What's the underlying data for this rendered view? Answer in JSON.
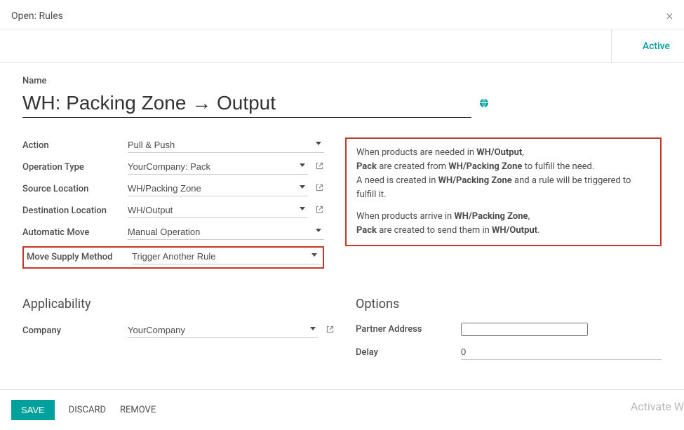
{
  "header": {
    "title": "Open: Rules"
  },
  "status": {
    "active_label": "Active"
  },
  "name": {
    "label": "Name",
    "value": "WH: Packing Zone → Output"
  },
  "fields": {
    "action": {
      "label": "Action",
      "value": "Pull & Push"
    },
    "operation_type": {
      "label": "Operation Type",
      "value": "YourCompany: Pack"
    },
    "source_location": {
      "label": "Source Location",
      "value": "WH/Packing Zone"
    },
    "destination_location": {
      "label": "Destination Location",
      "value": "WH/Output"
    },
    "automatic_move": {
      "label": "Automatic Move",
      "value": "Manual Operation"
    },
    "move_supply_method": {
      "label": "Move Supply Method",
      "value": "Trigger Another Rule"
    }
  },
  "description": {
    "part1_a": "When products are needed in ",
    "part1_b": "WH/Output",
    "part1_c": ",",
    "part2_a": "Pack",
    "part2_b": " are created from ",
    "part2_c": "WH/Packing Zone",
    "part2_d": " to fulfill the need.",
    "part3_a": "A need is created in ",
    "part3_b": "WH/Packing Zone",
    "part3_c": " and a rule will be triggered to fulfill it.",
    "part4_a": "When products arrive in ",
    "part4_b": "WH/Packing Zone",
    "part4_c": ",",
    "part5_a": "Pack",
    "part5_b": " are created to send them in ",
    "part5_c": "WH/Output",
    "part5_d": "."
  },
  "applicability": {
    "title": "Applicability",
    "company": {
      "label": "Company",
      "value": "YourCompany"
    }
  },
  "options": {
    "title": "Options",
    "partner_address": {
      "label": "Partner Address",
      "value": ""
    },
    "delay": {
      "label": "Delay",
      "value": "0"
    }
  },
  "footer": {
    "save": "SAVE",
    "discard": "DISCARD",
    "remove": "REMOVE"
  },
  "watermark": "Activate W"
}
